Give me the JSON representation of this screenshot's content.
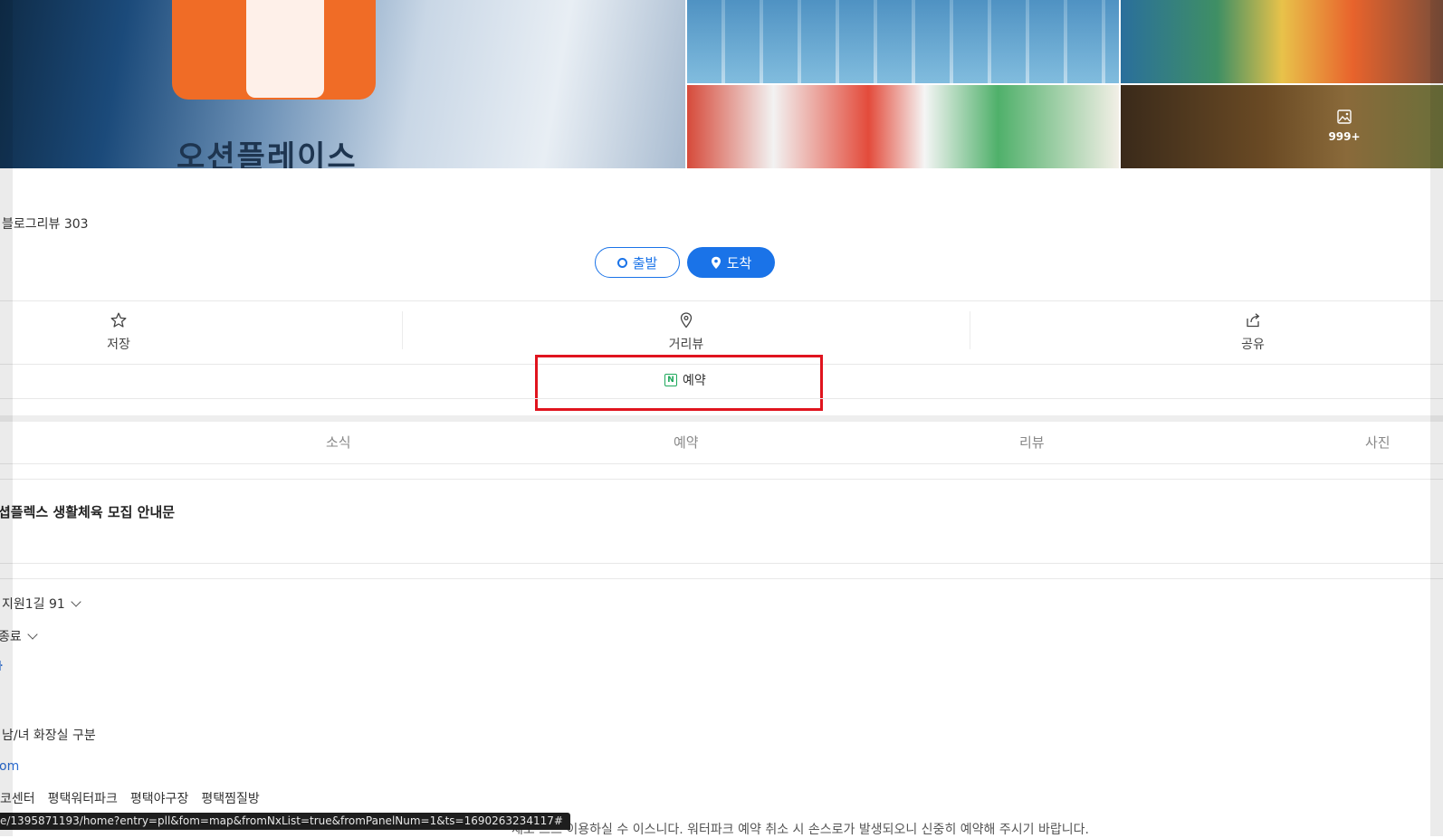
{
  "photos": {
    "main_sign_text": "오션플레이스",
    "more_count": "999+"
  },
  "summary": {
    "blog_review": "블로그리뷰 303"
  },
  "route": {
    "start_label": "출발",
    "arrive_label": "도착"
  },
  "actions": {
    "save_label": "저장",
    "streetview_label": "거리뷰",
    "share_label": "공유"
  },
  "booking": {
    "label": "예약"
  },
  "tabs": {
    "news": "소식",
    "booking": "예약",
    "review": "리뷰",
    "photo": "사진"
  },
  "notice": {
    "title": "셥플렉스 생활체육 모집 안내문"
  },
  "info": {
    "address": "지원1길 91",
    "hours": "종료",
    "link_fragment": "ŀ",
    "facility": "남/녀 화장실 구분",
    "website_fragment": "om"
  },
  "tags": [
    "코센터",
    "평택워터파크",
    "평택야구장",
    "평택찜질방"
  ],
  "status_bar": {
    "url": "e/1395871193/home?entry=pll&fom=map&fromNxList=true&fromPanelNum=1&ts=1690263234117#"
  },
  "cut_text": "채로 드으 이용하실 수 이스니다. 워터파크 예약 취소 시 손스로가 발생되오니 신중히 예약해 주시기 바랍니다."
}
